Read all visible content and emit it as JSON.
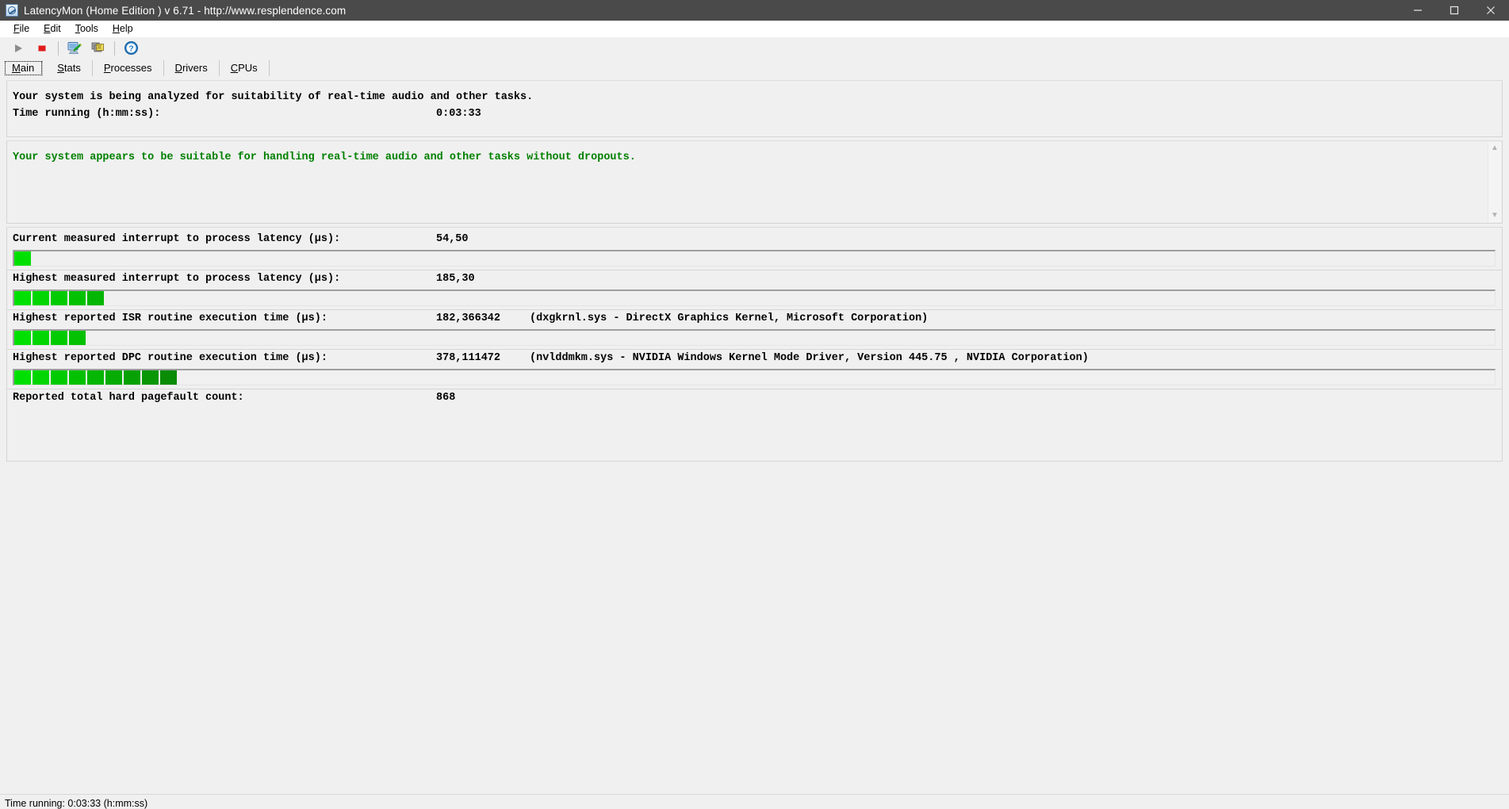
{
  "window": {
    "title": "LatencyMon  (Home Edition )  v 6.71 - http://www.resplendence.com",
    "icon": "latencymon-app-icon",
    "controls": {
      "minimize": "minimize-icon",
      "maximize": "maximize-icon",
      "close": "close-icon"
    }
  },
  "menubar": {
    "items": [
      {
        "label": "File",
        "accel": "F"
      },
      {
        "label": "Edit",
        "accel": "E"
      },
      {
        "label": "Tools",
        "accel": "T"
      },
      {
        "label": "Help",
        "accel": "H"
      }
    ]
  },
  "toolbar": {
    "buttons": [
      {
        "name": "start-button",
        "icon": "play-icon",
        "enabled": false
      },
      {
        "name": "stop-button",
        "icon": "stop-icon",
        "enabled": true
      },
      {
        "name": "report-button",
        "icon": "monitor-pen-icon",
        "enabled": true
      },
      {
        "name": "windows-button",
        "icon": "layered-windows-icon",
        "enabled": true
      },
      {
        "name": "help-button",
        "icon": "help-circle-icon",
        "enabled": true
      }
    ]
  },
  "tabs": [
    {
      "label": "Main",
      "accel": "M",
      "active": true
    },
    {
      "label": "Stats",
      "accel": "S",
      "active": false
    },
    {
      "label": "Processes",
      "accel": "P",
      "active": false
    },
    {
      "label": "Drivers",
      "accel": "D",
      "active": false
    },
    {
      "label": "CPUs",
      "accel": "C",
      "active": false
    }
  ],
  "summary": {
    "headline": "Your system is being analyzed for suitability of real-time audio and other tasks.",
    "time_label": "Time running (h:mm:ss):",
    "time_value": "0:03:33"
  },
  "verdict": {
    "text": "Your system appears to be suitable for handling real-time audio and other tasks without dropouts.",
    "color": "#008000"
  },
  "metrics": [
    {
      "label": "Current measured interrupt to process latency (µs):",
      "value": "54,50",
      "extra": "",
      "bar_segments": 1
    },
    {
      "label": "Highest measured interrupt to process latency (µs):",
      "value": "185,30",
      "extra": "",
      "bar_segments": 5
    },
    {
      "label": "Highest reported ISR routine execution time (µs):",
      "value": "182,366342",
      "extra": "(dxgkrnl.sys - DirectX Graphics Kernel, Microsoft Corporation)",
      "bar_segments": 4
    },
    {
      "label": "Highest reported DPC routine execution time (µs):",
      "value": "378,111472",
      "extra": "(nvlddmkm.sys - NVIDIA Windows Kernel Mode Driver, Version 445.75 , NVIDIA Corporation)",
      "bar_segments": 9
    },
    {
      "label": "Reported total hard pagefault count:",
      "value": "868",
      "extra": "",
      "bar_segments": 0
    }
  ],
  "scrollbar": {
    "up_arrow": "chevron-up-icon",
    "down_arrow": "chevron-down-icon"
  },
  "statusbar": {
    "text": "Time running: 0:03:33  (h:mm:ss)"
  },
  "colors": {
    "titlebar": "#4a4a4a",
    "bar_green_bright": "#00e000",
    "bar_green_dark": "#0a9e06",
    "verdict_green": "#008000",
    "window_bg": "#f0f0f0"
  }
}
